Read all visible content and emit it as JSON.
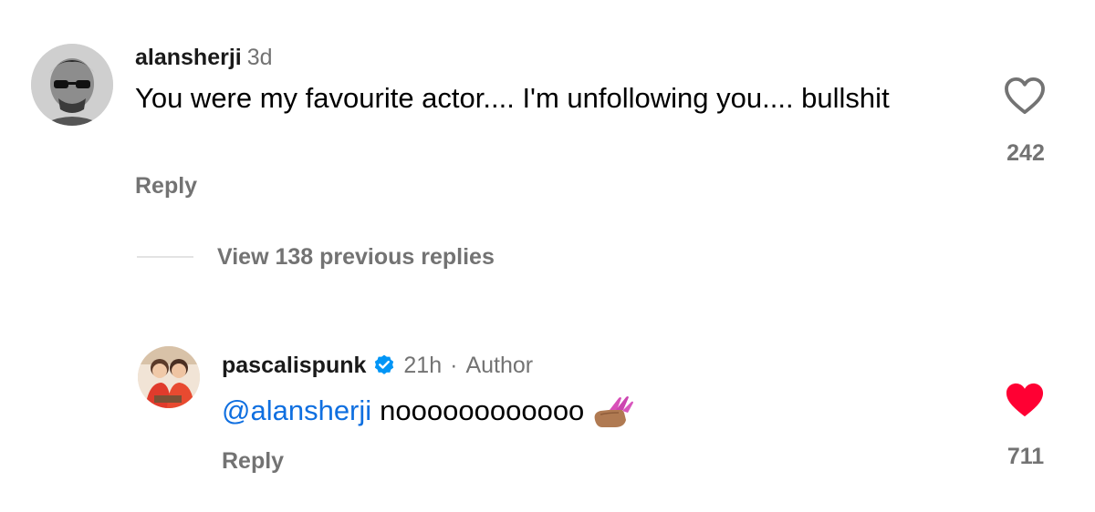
{
  "comments": [
    {
      "username": "alansherji",
      "time": "3d",
      "text": "You were my favourite actor.... I'm unfollowing you.... bullshit",
      "reply_label": "Reply",
      "like_count": "242",
      "liked": false
    },
    {
      "username": "pascalispunk",
      "verified": true,
      "time": "21h",
      "separator": "·",
      "author_badge": "Author",
      "mention": "@alansherji",
      "text": "noooooooooooo",
      "emoji": "nail-polish-emoji",
      "reply_label": "Reply",
      "like_count": "711",
      "liked": true
    }
  ],
  "view_replies": {
    "label": "View 138 previous replies"
  },
  "colors": {
    "text": "#000000",
    "secondary": "#737373",
    "mention": "#0f6fe0",
    "like_active": "#ff0033",
    "verified": "#0095f6"
  }
}
